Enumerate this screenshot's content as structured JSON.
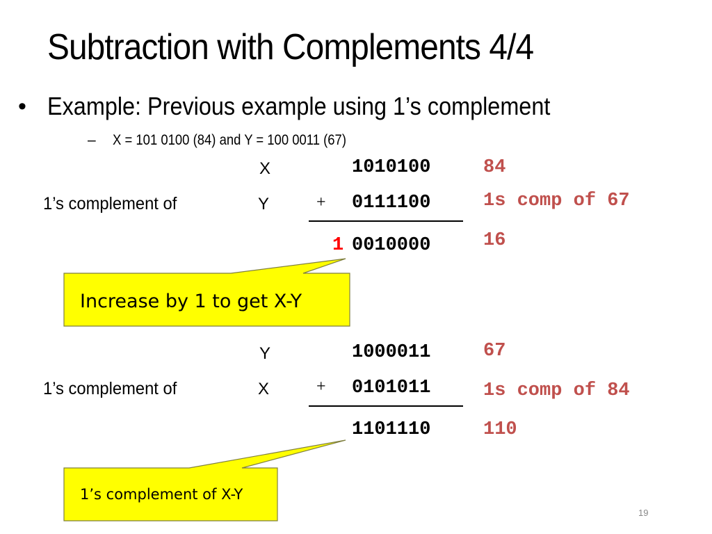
{
  "slide": {
    "title": "Subtraction with Complements 4/4",
    "bullet": {
      "marker": "•",
      "text": "Example: Previous example using 1’s complement"
    },
    "sub_bullet": {
      "marker": "–",
      "text": "X = 101 0100 (84) and Y = 100 0011 (67)"
    },
    "page_number": "19"
  },
  "example1": {
    "row1": {
      "label": "",
      "var": "X",
      "op": "",
      "binary": "1010100",
      "note": "84"
    },
    "row2": {
      "label": "1’s complement of",
      "var": "Y",
      "op": "+",
      "binary": "0111100",
      "note": "1s comp of 67"
    },
    "result": {
      "carry": "1",
      "binary": "0010000",
      "note": "16"
    },
    "callout": "Increase by 1 to get X-Y"
  },
  "example2": {
    "row1": {
      "label": "",
      "var": "Y",
      "op": "",
      "binary": "1000011",
      "note": "67"
    },
    "row2": {
      "label": "1’s complement of",
      "var": "X",
      "op": "+",
      "binary": "0101011",
      "note": "1s comp of 84"
    },
    "result": {
      "carry": "",
      "binary": "1101110",
      "note": "110"
    },
    "callout": "1’s complement of X-Y"
  },
  "colors": {
    "note_red": "#c0504d",
    "carry_red": "#ff0000",
    "callout_fill": "#ffff00",
    "callout_border": "#7f7f3f"
  }
}
